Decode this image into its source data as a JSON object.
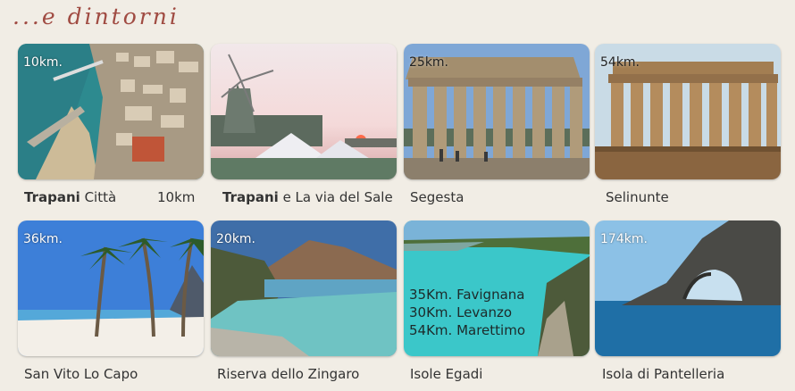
{
  "section_title": "...e dintorni",
  "places": [
    {
      "distance": "10km.",
      "bold": "Trapani",
      "rest": " Città",
      "km": "10km"
    },
    {
      "distance": "",
      "bold": "Trapani",
      "rest": " e La via del Sale"
    },
    {
      "distance": "25km.",
      "bold": "",
      "rest": "Segesta"
    },
    {
      "distance": "54km.",
      "bold": "",
      "rest": "Selinunte"
    },
    {
      "distance": "36km.",
      "bold": "",
      "rest": "San Vito Lo Capo"
    },
    {
      "distance": "20km.",
      "bold": "",
      "rest": "Riserva dello Zingaro"
    },
    {
      "distance": "",
      "bold": "",
      "rest": "Isole Egadi",
      "islands": [
        "35Km. Favignana",
        "30Km. Levanzo",
        "54Km. Marettimo"
      ]
    },
    {
      "distance": "174km.",
      "bold": "",
      "rest": "Isola di Pantelleria"
    }
  ]
}
